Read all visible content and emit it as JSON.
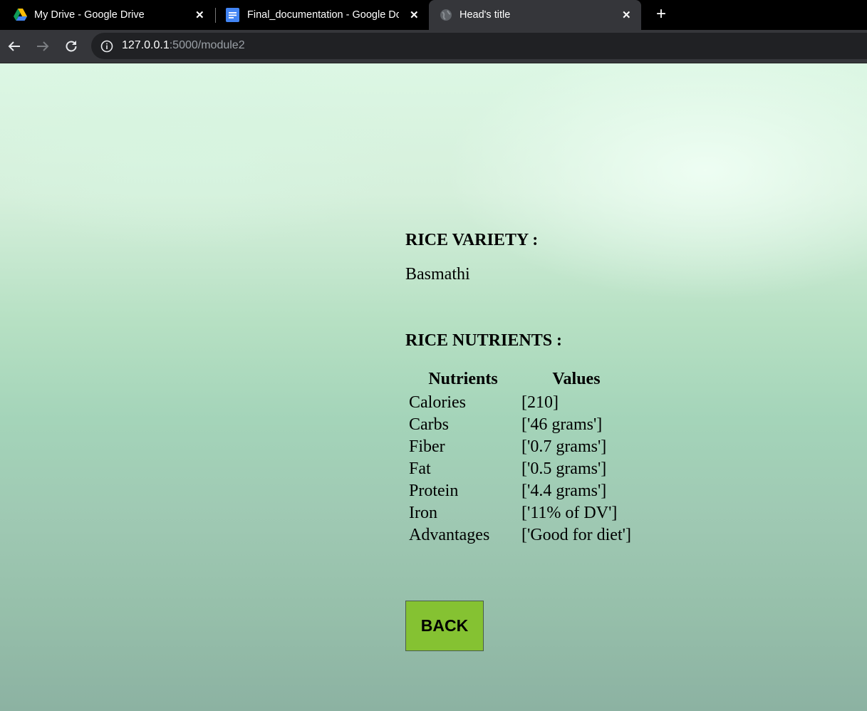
{
  "browser": {
    "tabs": [
      {
        "title": "My Drive - Google Drive",
        "icon": "google-drive-icon"
      },
      {
        "title": "Final_documentation - Google Docs",
        "icon": "google-docs-icon"
      },
      {
        "title": "Head's title",
        "icon": "globe-icon",
        "active": true
      }
    ],
    "url_host": "127.0.0.1",
    "url_rest": ":5000/module2"
  },
  "page": {
    "variety_heading": "RICE VARIETY :",
    "variety_value": "Basmathi",
    "nutrients_heading": "RICE NUTRIENTS :",
    "table": {
      "headers": [
        "Nutrients",
        "Values"
      ],
      "rows": [
        [
          "Calories",
          "[210]"
        ],
        [
          "Carbs",
          "['46 grams']"
        ],
        [
          "Fiber",
          "['0.7 grams']"
        ],
        [
          "Fat",
          "['0.5 grams']"
        ],
        [
          "Protein",
          "['4.4 grams']"
        ],
        [
          "Iron",
          "['11% of DV']"
        ],
        [
          "Advantages",
          "['Good for diet']"
        ]
      ]
    },
    "back_label": "BACK",
    "colors": {
      "button": "#85c232"
    }
  }
}
